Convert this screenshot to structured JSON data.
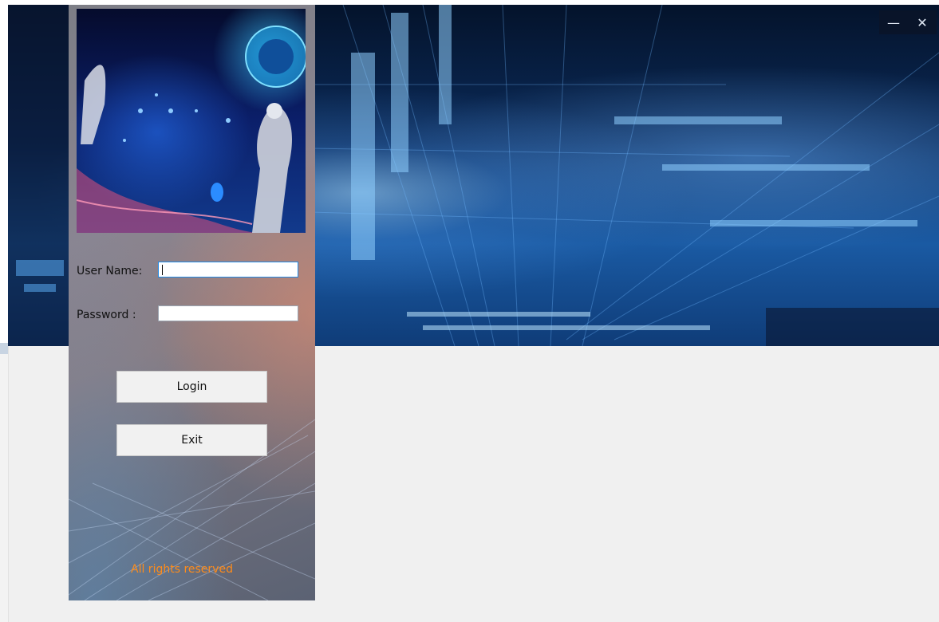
{
  "window": {
    "minimize_glyph": "—",
    "close_glyph": "✕"
  },
  "login": {
    "username_label": "User Name:",
    "username_value": "",
    "password_label": "Password :",
    "password_value": "",
    "login_button": "Login",
    "exit_button": "Exit"
  },
  "footer": {
    "text": "All rights reserved"
  },
  "colors": {
    "footer_text": "#ff8c1a",
    "focus_border": "#1e88e5",
    "button_face": "#f1f1f1",
    "window_background": "#f0f0f0"
  },
  "icons": {
    "minimize": "minimize-icon",
    "close": "close-icon"
  }
}
